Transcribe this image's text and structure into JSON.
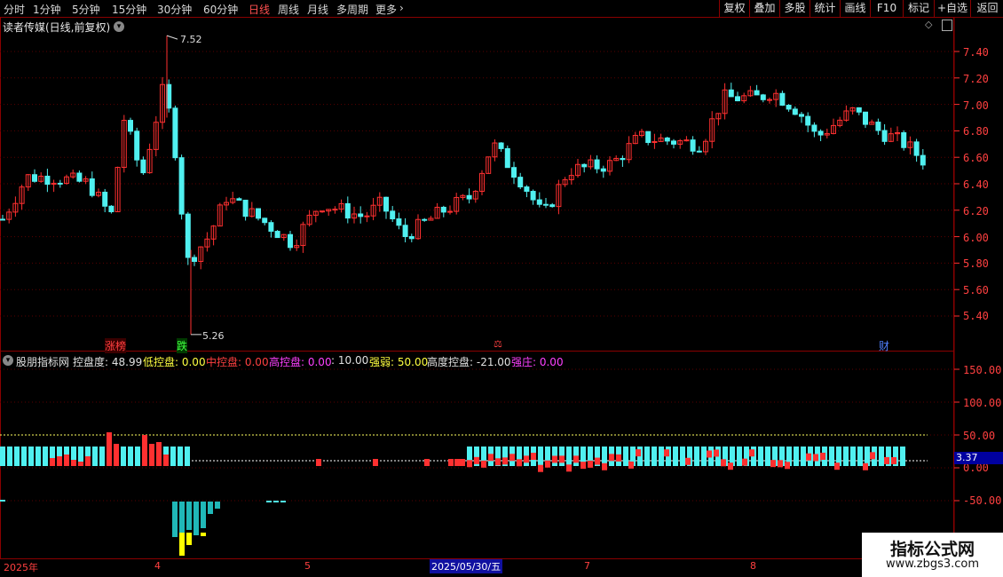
{
  "toolbar": {
    "left_items": [
      "分时",
      "1分钟",
      "5分钟",
      "15分钟",
      "30分钟",
      "60分钟",
      "日线",
      "周线",
      "月线",
      "多周期",
      "更多"
    ],
    "active": "日线",
    "right_items": [
      "复权",
      "叠加",
      "多股",
      "统计",
      "画线",
      "F10",
      "标记",
      "+自选",
      "返回"
    ]
  },
  "stock": {
    "title": "读者传媒(日线,前复权)",
    "high_label": "7.52",
    "low_label": "5.26"
  },
  "price_axis": [
    "7.40",
    "7.20",
    "7.00",
    "6.80",
    "6.60",
    "6.40",
    "6.20",
    "6.00",
    "5.80",
    "5.60",
    "5.40"
  ],
  "markers": [
    {
      "text": "涨榜",
      "color": "#ff4040"
    },
    {
      "text": "跌",
      "color": "#40ff40"
    },
    {
      "text": "⚖",
      "color": "#ff4040"
    },
    {
      "text": "财",
      "color": "#5080ff"
    }
  ],
  "indicator": {
    "name": "股朋指标网",
    "items": [
      {
        "label": "控盘度: 48.99",
        "color": "#e0e0e0"
      },
      {
        "label": "低控盘: 0.00",
        "color": "#ffff40"
      },
      {
        "label": "中控盘: 0.00",
        "color": "#ff4040"
      },
      {
        "label": "高控盘: 0.00",
        "color": "#ff40ff"
      },
      {
        "label": ": 10.00",
        "color": "#e0e0e0"
      },
      {
        "label": "强弱: 50.00",
        "color": "#ffff40"
      },
      {
        "label": "高度控盘: -21.00",
        "color": "#e0e0e0"
      },
      {
        "label": "强庄: 0.00",
        "color": "#ff40ff"
      }
    ],
    "axis": [
      "150.00",
      "100.00",
      "50.00",
      "0.00",
      "-50.00"
    ],
    "current_value": "3.37"
  },
  "time_axis": [
    "2025年",
    "4",
    "5",
    "2025/05/30/五",
    "7",
    "8"
  ],
  "watermark": {
    "line1": "指标公式网",
    "line2": "www.zbgs3.com"
  },
  "colors": {
    "up": "#ff3030",
    "down": "#50f0f0",
    "grid": "#5a0000",
    "frame": "#8a0000"
  }
}
